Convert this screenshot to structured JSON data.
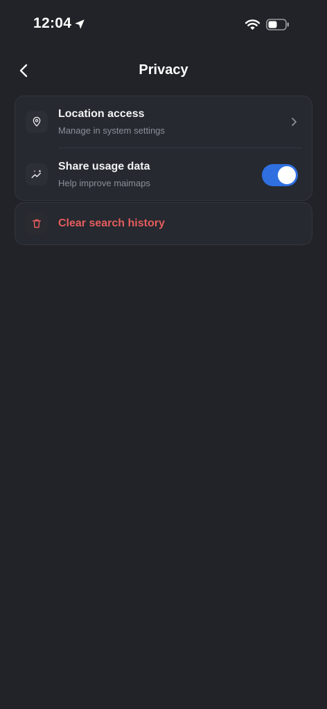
{
  "status_bar": {
    "time": "12:04",
    "icons": [
      "location-arrow-icon",
      "wifi-icon",
      "battery-icon"
    ]
  },
  "header": {
    "title": "Privacy",
    "back_icon": "chevron-left-icon"
  },
  "settings": {
    "location": {
      "title": "Location access",
      "subtitle": "Manage in system settings",
      "icon": "map-pin-icon"
    },
    "usage": {
      "title": "Share usage data",
      "subtitle": "Help improve maimaps",
      "icon": "sparkle-chart-icon",
      "enabled": true
    },
    "clear_history": {
      "label": "Clear search history",
      "icon": "trash-icon"
    }
  },
  "colors": {
    "background": "#212328",
    "card": "#26292f",
    "accent": "#2f6fe0",
    "danger": "#e55d5d"
  }
}
